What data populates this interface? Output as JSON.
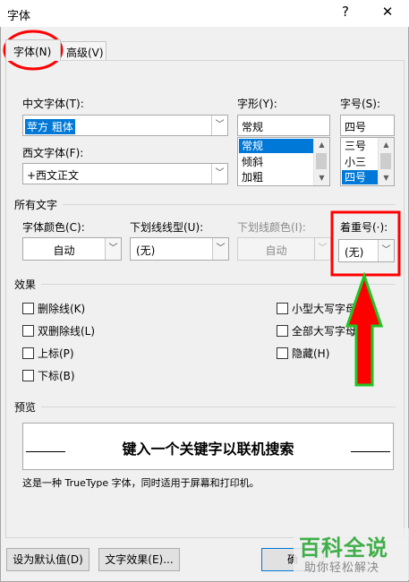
{
  "window": {
    "title": "字体",
    "help_icon": "?",
    "close_icon": "✕"
  },
  "tabs": [
    {
      "label": "字体(N)",
      "active": true
    },
    {
      "label": "高级(V)",
      "active": false
    }
  ],
  "font_section": {
    "chinese_font_label": "中文字体(T):",
    "chinese_font_value": "苹方 粗体",
    "western_font_label": "西文字体(F):",
    "western_font_value": "+西文正文",
    "style_label": "字形(Y):",
    "style_value": "常规",
    "style_options": [
      "常规",
      "倾斜",
      "加粗"
    ],
    "style_selected": "常规",
    "size_label": "字号(S):",
    "size_value": "四号",
    "size_options": [
      "三号",
      "小三",
      "四号"
    ],
    "size_selected": "四号"
  },
  "all_text": {
    "section_label": "所有文字",
    "font_color_label": "字体颜色(C):",
    "font_color_value": "自动",
    "underline_style_label": "下划线线型(U):",
    "underline_style_value": "(无)",
    "underline_color_label": "下划线颜色(I):",
    "underline_color_value": "自动",
    "emphasis_label": "着重号(·):",
    "emphasis_value": "(无)"
  },
  "effects": {
    "section_label": "效果",
    "left": [
      {
        "label": "删除线(K)",
        "checked": false
      },
      {
        "label": "双删除线(L)",
        "checked": false
      },
      {
        "label": "上标(P)",
        "checked": false
      },
      {
        "label": "下标(B)",
        "checked": false
      }
    ],
    "right": [
      {
        "label": "小型大写字母(M)",
        "checked": false
      },
      {
        "label": "全部大写字母(A)",
        "checked": false
      },
      {
        "label": "隐藏(H)",
        "checked": false
      }
    ]
  },
  "preview": {
    "section_label": "预览",
    "sample_text": "键入一个关键字以联机搜索",
    "note": "这是一种 TrueType 字体，同时适用于屏幕和打印机。"
  },
  "footer": {
    "set_default_label": "设为默认值(D)",
    "text_effects_label": "文字效果(E)...",
    "ok_label": "确"
  },
  "watermark": {
    "line1": "百科全说",
    "line2": "助你轻松解决"
  },
  "colors": {
    "annotation_red": "#ff0000",
    "arrow_green": "#22c322",
    "selection_blue": "#0078d7"
  }
}
